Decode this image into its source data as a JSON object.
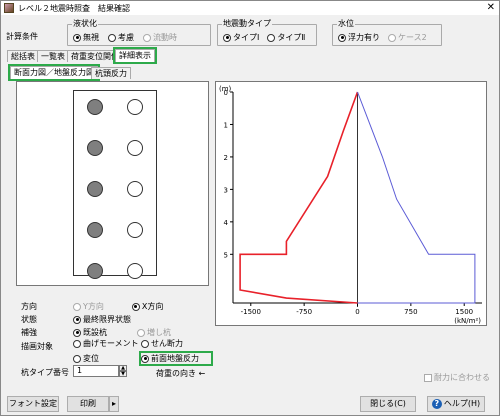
{
  "window": {
    "title": "レベル２地震時照査　結果確認",
    "close_glyph": "✕"
  },
  "conditions": {
    "label": "計算条件",
    "liquefaction": {
      "title": "液状化",
      "options": [
        {
          "label": "無視",
          "selected": true,
          "disabled": false
        },
        {
          "label": "考慮",
          "selected": false,
          "disabled": false
        },
        {
          "label": "流動時",
          "selected": false,
          "disabled": true
        }
      ]
    },
    "motion": {
      "title": "地震動タイプ",
      "options": [
        {
          "label": "タイプⅠ",
          "selected": true,
          "disabled": false
        },
        {
          "label": "タイプⅡ",
          "selected": false,
          "disabled": false
        }
      ]
    },
    "water": {
      "title": "水位",
      "options": [
        {
          "label": "浮力有り",
          "selected": true,
          "disabled": false
        },
        {
          "label": "ケース2",
          "selected": false,
          "disabled": true
        }
      ]
    }
  },
  "tabs": [
    "総括表",
    "一覧表",
    "荷重変位関係",
    "詳細表示"
  ],
  "subtabs": [
    "断面力図／地盤反力図",
    "杭頭反力"
  ],
  "settings": {
    "direction": {
      "label": "方向",
      "options": [
        {
          "label": "Y方向",
          "selected": false,
          "disabled": true
        },
        {
          "label": "X方向",
          "selected": true,
          "disabled": false
        }
      ]
    },
    "state": {
      "label": "状態",
      "options": [
        {
          "label": "最終限界状態",
          "selected": true,
          "disabled": false
        }
      ]
    },
    "reinforce": {
      "label": "補強",
      "options": [
        {
          "label": "既設杭",
          "selected": true,
          "disabled": false
        },
        {
          "label": "増し杭",
          "selected": false,
          "disabled": true
        }
      ]
    },
    "target": {
      "label": "描画対象",
      "options": [
        {
          "label": "曲げモーメント",
          "selected": false,
          "disabled": false
        },
        {
          "label": "せん断力",
          "selected": false,
          "disabled": false
        },
        {
          "label": "変位",
          "selected": false,
          "disabled": false
        },
        {
          "label": "前面地盤反力",
          "selected": true,
          "disabled": false
        }
      ]
    },
    "pile_type": {
      "label": "杭タイプ番号",
      "value": "1"
    },
    "load_dir": "荷重の向き ←"
  },
  "piles": [
    [
      "gray",
      "white"
    ],
    [
      "gray",
      "white"
    ],
    [
      "gray",
      "white"
    ],
    [
      "gray",
      "white"
    ],
    [
      "gray",
      "white"
    ]
  ],
  "chart_data": {
    "type": "line",
    "yunit": "(m)",
    "xunit": "(kN/m²)",
    "yticks": [
      0,
      1,
      2,
      3,
      4,
      5
    ],
    "xticks": [
      -1500,
      -750,
      0,
      750,
      1500
    ],
    "xlim": [
      -1750,
      1750
    ],
    "ylim": [
      0,
      6.5
    ],
    "series": [
      {
        "color": "#e8212a",
        "points": [
          [
            0,
            0
          ],
          [
            -200,
            1.2
          ],
          [
            -420,
            2.6
          ],
          [
            -1000,
            4.6
          ],
          [
            -1000,
            5.0
          ],
          [
            -1650,
            5.0
          ],
          [
            -1650,
            6.1
          ],
          [
            -1000,
            6.35
          ],
          [
            0,
            6.5
          ]
        ]
      },
      {
        "color": "#5b5bd6",
        "points": [
          [
            0,
            0
          ],
          [
            350,
            2.0
          ],
          [
            550,
            3.3
          ],
          [
            1000,
            5.0
          ],
          [
            1650,
            5.0
          ],
          [
            1650,
            6.5
          ],
          [
            0,
            6.5
          ]
        ]
      }
    ],
    "fit_label": "耐力に合わせる",
    "fit_checked": false
  },
  "footer": {
    "font_button": "フォント設定",
    "print_button": "印刷",
    "print_arrow": "▸",
    "close_button": "閉じる(C)",
    "help_button": "ヘルプ(H)",
    "help_icon": "?"
  }
}
